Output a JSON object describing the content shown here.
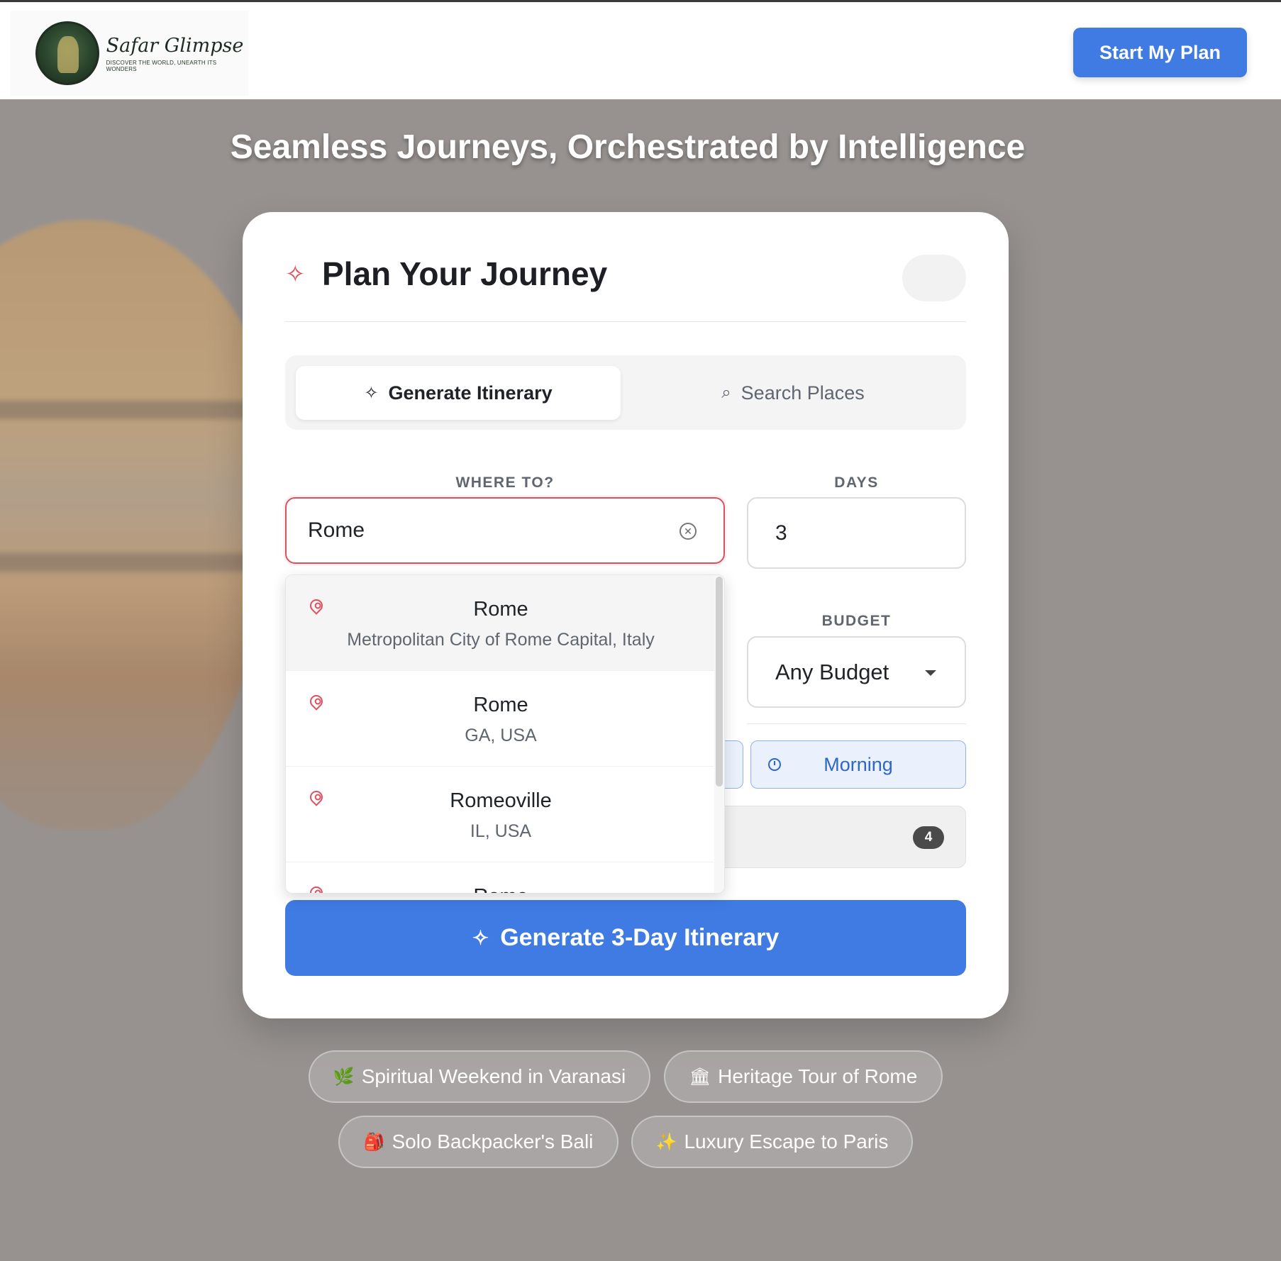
{
  "header": {
    "logo_name": "Safar Glimpse",
    "logo_tagline": "DISCOVER THE WORLD, UNEARTH ITS WONDERS",
    "cta_label": "Start My Plan"
  },
  "hero": {
    "title": "Seamless Journeys, Orchestrated by Intelligence"
  },
  "planner": {
    "title": "Plan Your Journey",
    "tabs": [
      {
        "label": "Generate Itinerary",
        "icon": "sparkle-icon",
        "active": true
      },
      {
        "label": "Search Places",
        "icon": "search-icon",
        "active": false
      }
    ],
    "where_label": "WHERE TO?",
    "where_value": "Rome",
    "days_label": "DAYS",
    "days_value": "3",
    "budget_label": "BUDGET",
    "budget_value": "Any Budget",
    "time_of_day": "Morning",
    "interests_count": "4",
    "generate_label": "Generate 3-Day Itinerary"
  },
  "suggestions": [
    {
      "title": "Rome",
      "subtitle": "Metropolitan City of Rome Capital, Italy"
    },
    {
      "title": "Rome",
      "subtitle": "GA, USA"
    },
    {
      "title": "Romeoville",
      "subtitle": "IL, USA"
    },
    {
      "title": "Rome",
      "subtitle": ""
    }
  ],
  "quick_trips": [
    {
      "emoji": "🌿",
      "label": "Spiritual Weekend in Varanasi"
    },
    {
      "emoji": "🏛",
      "label": "Heritage Tour of Rome"
    },
    {
      "emoji": "🎒",
      "label": "Solo Backpacker's Bali"
    },
    {
      "emoji": "✨",
      "label": "Luxury Escape to Paris"
    }
  ],
  "colors": {
    "accent": "#3f7be3",
    "highlight": "#e04f5f"
  }
}
